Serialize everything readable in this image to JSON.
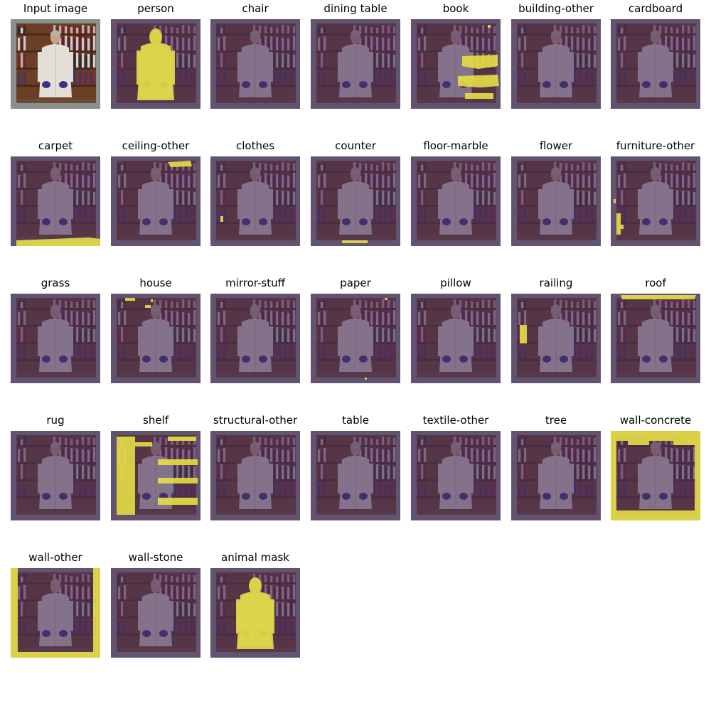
{
  "figure": {
    "panels": [
      {
        "title": "Input image",
        "kind": "input"
      },
      {
        "title": "person",
        "kind": "mask",
        "mask": "person"
      },
      {
        "title": "chair",
        "kind": "mask",
        "mask": "none"
      },
      {
        "title": "dining table",
        "kind": "mask",
        "mask": "none"
      },
      {
        "title": "book",
        "kind": "mask",
        "mask": "book"
      },
      {
        "title": "building-other",
        "kind": "mask",
        "mask": "none"
      },
      {
        "title": "cardboard",
        "kind": "mask",
        "mask": "none"
      },
      {
        "title": "carpet",
        "kind": "mask",
        "mask": "bottom-strip"
      },
      {
        "title": "ceiling-other",
        "kind": "mask",
        "mask": "top-right-blob"
      },
      {
        "title": "clothes",
        "kind": "mask",
        "mask": "tiny-left"
      },
      {
        "title": "counter",
        "kind": "mask",
        "mask": "bottom-small"
      },
      {
        "title": "floor-marble",
        "kind": "mask",
        "mask": "none"
      },
      {
        "title": "flower",
        "kind": "mask",
        "mask": "none"
      },
      {
        "title": "furniture-other",
        "kind": "mask",
        "mask": "left-specks"
      },
      {
        "title": "grass",
        "kind": "mask",
        "mask": "none"
      },
      {
        "title": "house",
        "kind": "mask",
        "mask": "top-left-specks"
      },
      {
        "title": "mirror-stuff",
        "kind": "mask",
        "mask": "none"
      },
      {
        "title": "paper",
        "kind": "mask",
        "mask": "top-right-speck"
      },
      {
        "title": "pillow",
        "kind": "mask",
        "mask": "none"
      },
      {
        "title": "railing",
        "kind": "mask",
        "mask": "left-bar"
      },
      {
        "title": "roof",
        "kind": "mask",
        "mask": "top-strip"
      },
      {
        "title": "rug",
        "kind": "mask",
        "mask": "none"
      },
      {
        "title": "shelf",
        "kind": "mask",
        "mask": "shelf"
      },
      {
        "title": "structural-other",
        "kind": "mask",
        "mask": "none"
      },
      {
        "title": "table",
        "kind": "mask",
        "mask": "none"
      },
      {
        "title": "textile-other",
        "kind": "mask",
        "mask": "none"
      },
      {
        "title": "tree",
        "kind": "mask",
        "mask": "none"
      },
      {
        "title": "wall-concrete",
        "kind": "mask",
        "mask": "border"
      },
      {
        "title": "wall-other",
        "kind": "mask",
        "mask": "side-border"
      },
      {
        "title": "wall-stone",
        "kind": "mask",
        "mask": "none"
      },
      {
        "title": "animal mask",
        "kind": "mask",
        "mask": "person"
      }
    ]
  },
  "colors": {
    "title_text": "#000000",
    "mask_highlight": "#e7df45",
    "mask_background": "#4a2f5c",
    "coat": "#e2dfd8",
    "gloves": "#3b2f8a",
    "shelf_wood": "#6a3f25",
    "stone_frame": "#8a8f90"
  }
}
